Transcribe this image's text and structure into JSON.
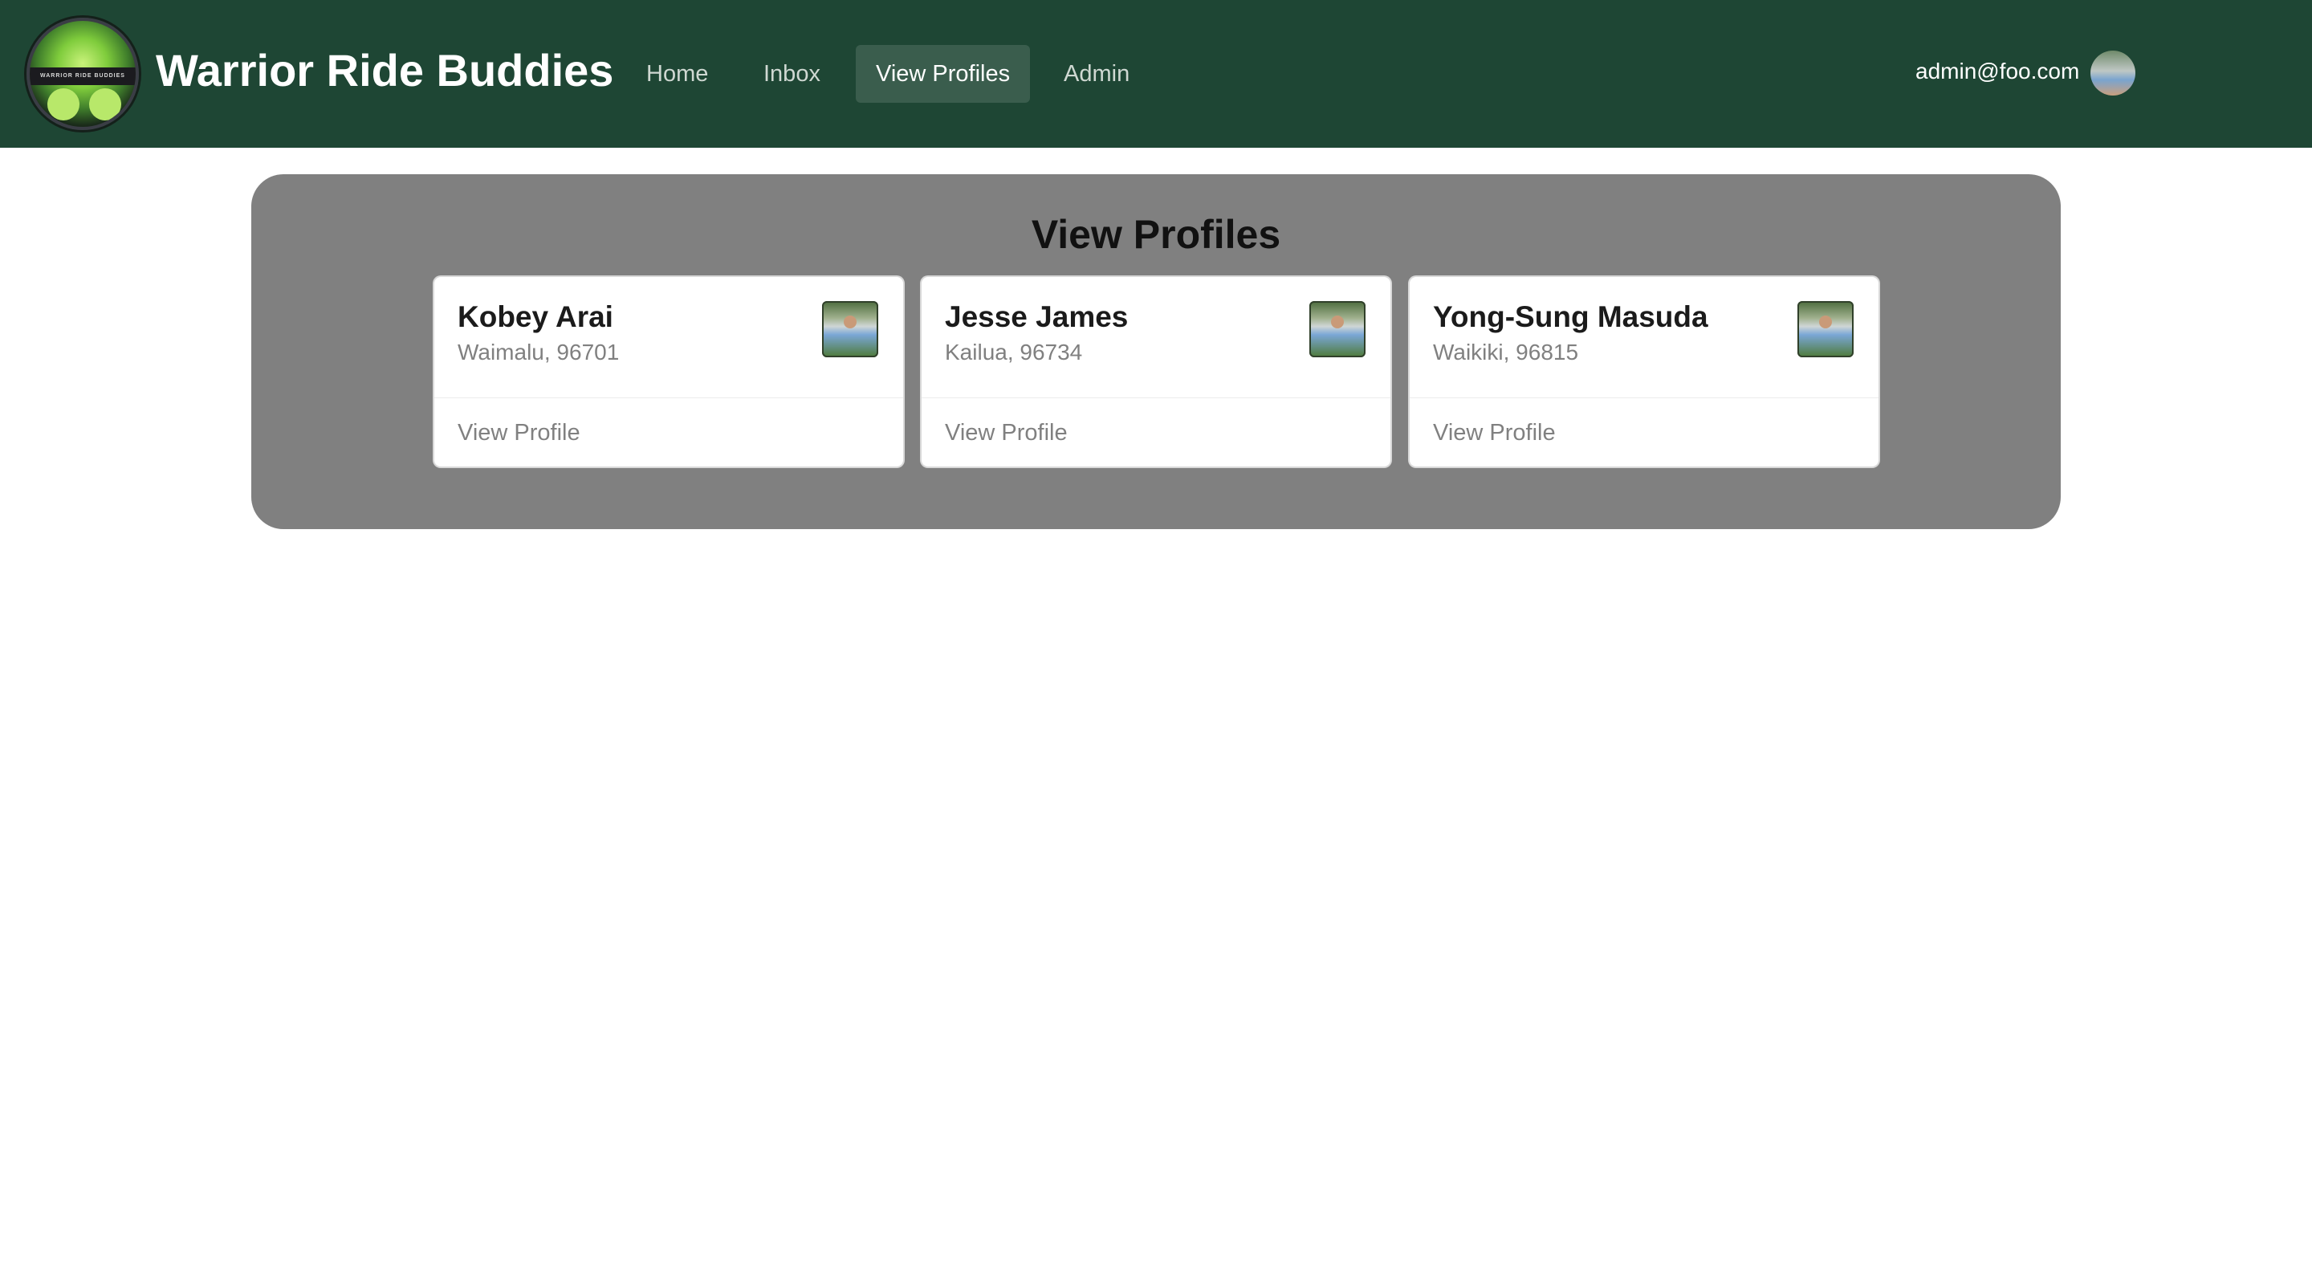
{
  "navbar": {
    "brand_title": "Warrior Ride Buddies",
    "logo_text": "WARRIOR RIDE BUDDIES",
    "items": [
      {
        "label": "Home",
        "active": false
      },
      {
        "label": "Inbox",
        "active": false
      },
      {
        "label": "View Profiles",
        "active": true
      },
      {
        "label": "Admin",
        "active": false
      }
    ],
    "user_email": "admin@foo.com",
    "bg_color": "#1e4634"
  },
  "main": {
    "title": "View Profiles",
    "profiles": [
      {
        "name": "Kobey Arai",
        "location": "Waimalu, 96701",
        "link_label": "View Profile"
      },
      {
        "name": "Jesse James",
        "location": "Kailua, 96734",
        "link_label": "View Profile"
      },
      {
        "name": "Yong-Sung Masuda",
        "location": "Waikiki, 96815",
        "link_label": "View Profile"
      }
    ]
  }
}
